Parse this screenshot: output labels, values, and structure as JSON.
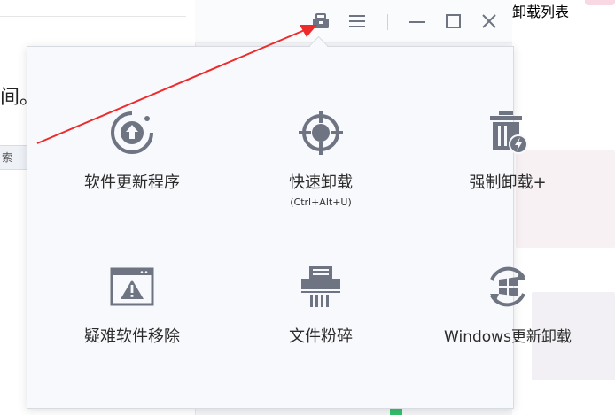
{
  "background": {
    "left_fragment_1": "间。",
    "left_fragment_2": "索",
    "right_fragment_1": "卸载列表"
  },
  "titlebar": {
    "buttons": [
      {
        "icon": "toolbox-icon"
      },
      {
        "icon": "menu-icon"
      },
      {
        "icon": "minimize-icon"
      },
      {
        "icon": "maximize-icon"
      },
      {
        "icon": "close-icon"
      }
    ]
  },
  "tools": [
    {
      "label": "软件更新程序",
      "icon": "update-arrow-icon"
    },
    {
      "label": "快速卸载",
      "sub": "(Ctrl+Alt+U)",
      "icon": "target-crosshair-icon"
    },
    {
      "label": "强制卸载+",
      "icon": "trash-lightning-icon"
    },
    {
      "label": "疑难软件移除",
      "icon": "warning-window-icon"
    },
    {
      "label": "文件粉碎",
      "icon": "shredder-icon"
    },
    {
      "label": "Windows更新卸载",
      "icon": "windows-update-icon"
    }
  ],
  "colors": {
    "icon": "#6e7482",
    "annotation_arrow": "#ee2b2b"
  }
}
